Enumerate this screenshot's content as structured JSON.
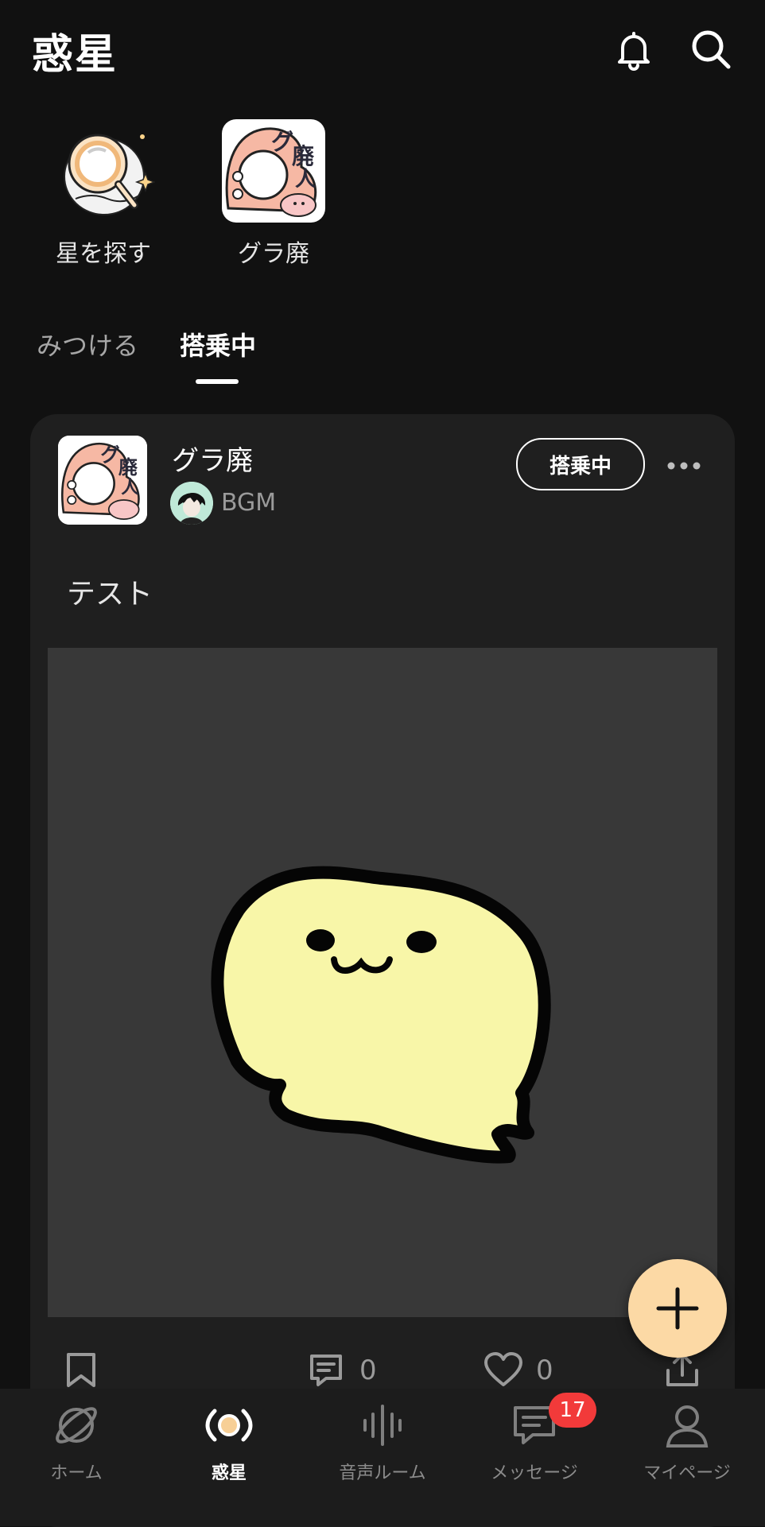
{
  "header": {
    "title": "惑星"
  },
  "shortcuts": [
    {
      "label": "星を探す"
    },
    {
      "label": "グラ廃"
    }
  ],
  "tabs": [
    {
      "label": "みつける",
      "active": false
    },
    {
      "label": "搭乗中",
      "active": true
    }
  ],
  "post": {
    "planet_name": "グラ廃",
    "channel_name": "BGM",
    "join_label": "搭乗中",
    "text": "テスト",
    "comment_count": "0",
    "like_count": "0"
  },
  "nav": {
    "items": [
      {
        "label": "ホーム",
        "active": false
      },
      {
        "label": "惑星",
        "active": true
      },
      {
        "label": "音声ルーム",
        "active": false
      },
      {
        "label": "メッセージ",
        "active": false
      },
      {
        "label": "マイページ",
        "active": false
      }
    ],
    "message_badge": "17"
  },
  "colors": {
    "background": "#111111",
    "card": "#1f1f1f",
    "fab": "#fcd9a5",
    "badge": "#f23a3a",
    "active_nav_icon": "#f7cf96"
  }
}
